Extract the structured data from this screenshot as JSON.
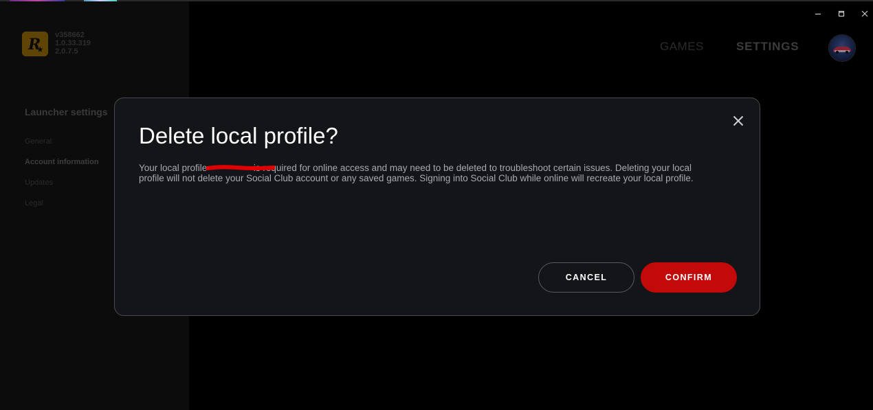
{
  "window": {
    "controls": {
      "minimize_icon": "minimize-icon",
      "maximize_icon": "maximize-icon",
      "close_icon": "close-icon"
    }
  },
  "header": {
    "versions": [
      "v358662",
      "1.0.33.319",
      "2.0.7.5"
    ],
    "nav": {
      "games": "GAMES",
      "settings": "SETTINGS"
    }
  },
  "sidebar": {
    "title": "Launcher settings",
    "items": [
      {
        "label": "General"
      },
      {
        "label": "Account information"
      },
      {
        "label": "Updates"
      },
      {
        "label": "Legal"
      }
    ]
  },
  "modal": {
    "title": "Delete local profile?",
    "body_line1": "Your local profile                  is required for online access and may need to be deleted to troubleshoot certain issues. Deleting your local",
    "body_line2": "profile will not delete your Social Club account or any saved games. Signing into Social Club while online will recreate your local profile.",
    "cancel_label": "CANCEL",
    "confirm_label": "CONFIRM"
  },
  "colors": {
    "accent_red": "#c20a0a",
    "logo_gold": "#c08a0c",
    "modal_bg": "#141519"
  }
}
